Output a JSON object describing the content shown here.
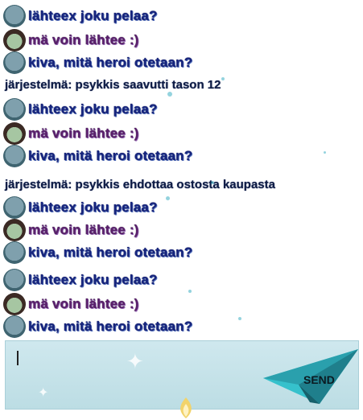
{
  "chat": {
    "messages": [
      {
        "type": "user",
        "avatar": "zombie-avatar",
        "text": "lähteex joku pelaa?"
      },
      {
        "type": "user",
        "avatar": "guy-avatar",
        "text": "mä voin lähtee :)"
      },
      {
        "type": "user",
        "avatar": "zombie-avatar",
        "text": "kiva, mitä heroi otetaan?"
      },
      {
        "type": "system",
        "text": "järjestelmä: psykkis saavutti tason 12"
      },
      {
        "type": "user",
        "avatar": "zombie-avatar",
        "text": "lähteex joku pelaa?"
      },
      {
        "type": "user",
        "avatar": "guy-avatar",
        "text": "mä voin lähtee :)"
      },
      {
        "type": "user",
        "avatar": "zombie-avatar",
        "text": "kiva, mitä heroi otetaan?"
      },
      {
        "type": "system",
        "text": "järjestelmä: psykkis ehdottaa ostosta kaupasta"
      },
      {
        "type": "user",
        "avatar": "zombie-avatar",
        "text": "lähteex joku pelaa?"
      },
      {
        "type": "user",
        "avatar": "guy-avatar",
        "text": "mä voin lähtee :)"
      },
      {
        "type": "user",
        "avatar": "zombie-avatar",
        "text": "kiva, mitä heroi otetaan?"
      },
      {
        "type": "user",
        "avatar": "zombie-avatar",
        "text": "lähteex joku pelaa?"
      },
      {
        "type": "user",
        "avatar": "guy-avatar",
        "text": "mä voin lähtee :)"
      },
      {
        "type": "user",
        "avatar": "zombie-avatar",
        "text": "kiva, mitä heroi otetaan?"
      }
    ]
  },
  "composer": {
    "input_value": "",
    "send_label": "SEND"
  },
  "colors": {
    "message_text": "#16247d",
    "purple_text": "#5a1f6b",
    "composer_bg": "#cfe8ee",
    "send_plane": "#2fb3c1"
  }
}
